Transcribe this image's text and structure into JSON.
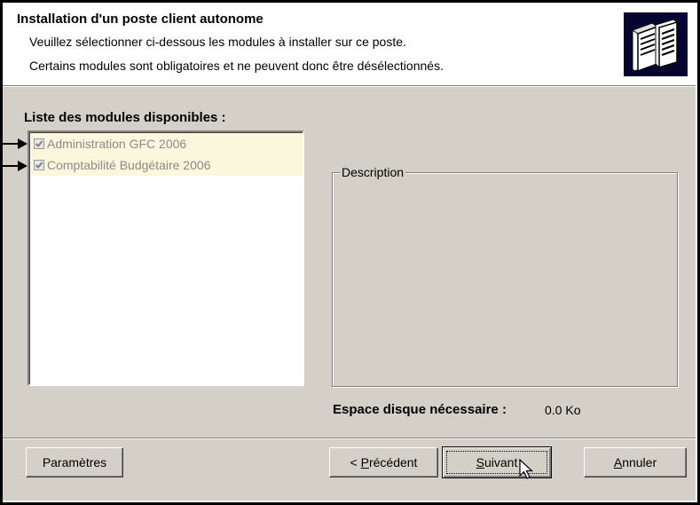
{
  "header": {
    "title": "Installation d'un poste client autonome",
    "line1": "Veuillez sélectionner ci-dessous les modules à installer sur ce poste.",
    "line2": "Certains modules sont obligatoires et ne peuvent donc être désélectionnés.",
    "logo_icon": "servers-icon"
  },
  "modules": {
    "label": "Liste des modules disponibles :",
    "items": [
      {
        "label": "Administration GFC 2006",
        "checked": true,
        "disabled": true
      },
      {
        "label": "Comptabilité Budgétaire 2006",
        "checked": true,
        "disabled": true
      }
    ]
  },
  "description": {
    "legend": "Description"
  },
  "disk": {
    "label": "Espace disque nécessaire :",
    "value": "0.0 Ko"
  },
  "buttons": {
    "params": "Paramètres",
    "prev_prefix": "< ",
    "prev_accel": "P",
    "prev_rest": "récédent",
    "next_accel": "S",
    "next_rest": "uivant",
    "cancel_accel": "A",
    "cancel_rest": "nnuler"
  },
  "colors": {
    "dialog_bg": "#d4d0c8",
    "header_bg": "#ffffff",
    "logo_bg": "#05052f",
    "disabled_item_bg": "#fbf7dc"
  }
}
